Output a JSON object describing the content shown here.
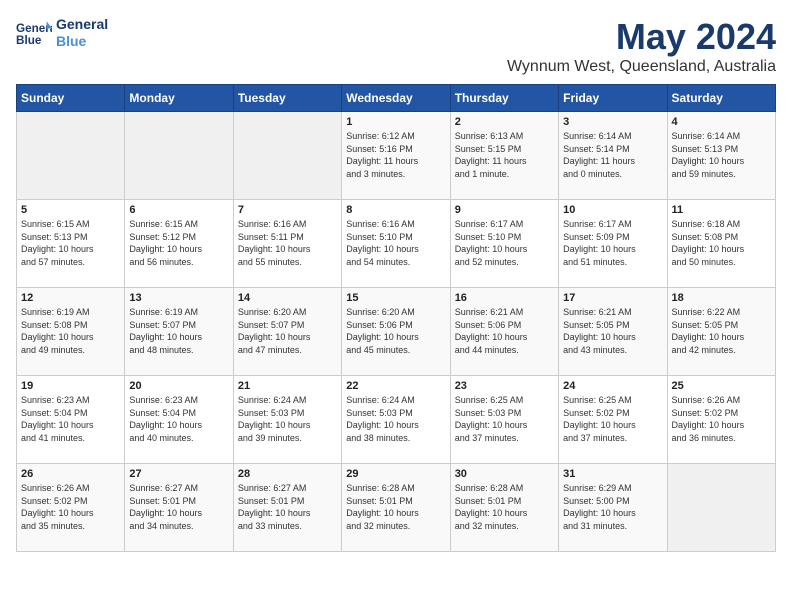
{
  "header": {
    "logo_line1": "General",
    "logo_line2": "Blue",
    "title": "May 2024",
    "subtitle": "Wynnum West, Queensland, Australia"
  },
  "days_of_week": [
    "Sunday",
    "Monday",
    "Tuesday",
    "Wednesday",
    "Thursday",
    "Friday",
    "Saturday"
  ],
  "weeks": [
    [
      {
        "day": "",
        "info": ""
      },
      {
        "day": "",
        "info": ""
      },
      {
        "day": "",
        "info": ""
      },
      {
        "day": "1",
        "info": "Sunrise: 6:12 AM\nSunset: 5:16 PM\nDaylight: 11 hours\nand 3 minutes."
      },
      {
        "day": "2",
        "info": "Sunrise: 6:13 AM\nSunset: 5:15 PM\nDaylight: 11 hours\nand 1 minute."
      },
      {
        "day": "3",
        "info": "Sunrise: 6:14 AM\nSunset: 5:14 PM\nDaylight: 11 hours\nand 0 minutes."
      },
      {
        "day": "4",
        "info": "Sunrise: 6:14 AM\nSunset: 5:13 PM\nDaylight: 10 hours\nand 59 minutes."
      }
    ],
    [
      {
        "day": "5",
        "info": "Sunrise: 6:15 AM\nSunset: 5:13 PM\nDaylight: 10 hours\nand 57 minutes."
      },
      {
        "day": "6",
        "info": "Sunrise: 6:15 AM\nSunset: 5:12 PM\nDaylight: 10 hours\nand 56 minutes."
      },
      {
        "day": "7",
        "info": "Sunrise: 6:16 AM\nSunset: 5:11 PM\nDaylight: 10 hours\nand 55 minutes."
      },
      {
        "day": "8",
        "info": "Sunrise: 6:16 AM\nSunset: 5:10 PM\nDaylight: 10 hours\nand 54 minutes."
      },
      {
        "day": "9",
        "info": "Sunrise: 6:17 AM\nSunset: 5:10 PM\nDaylight: 10 hours\nand 52 minutes."
      },
      {
        "day": "10",
        "info": "Sunrise: 6:17 AM\nSunset: 5:09 PM\nDaylight: 10 hours\nand 51 minutes."
      },
      {
        "day": "11",
        "info": "Sunrise: 6:18 AM\nSunset: 5:08 PM\nDaylight: 10 hours\nand 50 minutes."
      }
    ],
    [
      {
        "day": "12",
        "info": "Sunrise: 6:19 AM\nSunset: 5:08 PM\nDaylight: 10 hours\nand 49 minutes."
      },
      {
        "day": "13",
        "info": "Sunrise: 6:19 AM\nSunset: 5:07 PM\nDaylight: 10 hours\nand 48 minutes."
      },
      {
        "day": "14",
        "info": "Sunrise: 6:20 AM\nSunset: 5:07 PM\nDaylight: 10 hours\nand 47 minutes."
      },
      {
        "day": "15",
        "info": "Sunrise: 6:20 AM\nSunset: 5:06 PM\nDaylight: 10 hours\nand 45 minutes."
      },
      {
        "day": "16",
        "info": "Sunrise: 6:21 AM\nSunset: 5:06 PM\nDaylight: 10 hours\nand 44 minutes."
      },
      {
        "day": "17",
        "info": "Sunrise: 6:21 AM\nSunset: 5:05 PM\nDaylight: 10 hours\nand 43 minutes."
      },
      {
        "day": "18",
        "info": "Sunrise: 6:22 AM\nSunset: 5:05 PM\nDaylight: 10 hours\nand 42 minutes."
      }
    ],
    [
      {
        "day": "19",
        "info": "Sunrise: 6:23 AM\nSunset: 5:04 PM\nDaylight: 10 hours\nand 41 minutes."
      },
      {
        "day": "20",
        "info": "Sunrise: 6:23 AM\nSunset: 5:04 PM\nDaylight: 10 hours\nand 40 minutes."
      },
      {
        "day": "21",
        "info": "Sunrise: 6:24 AM\nSunset: 5:03 PM\nDaylight: 10 hours\nand 39 minutes."
      },
      {
        "day": "22",
        "info": "Sunrise: 6:24 AM\nSunset: 5:03 PM\nDaylight: 10 hours\nand 38 minutes."
      },
      {
        "day": "23",
        "info": "Sunrise: 6:25 AM\nSunset: 5:03 PM\nDaylight: 10 hours\nand 37 minutes."
      },
      {
        "day": "24",
        "info": "Sunrise: 6:25 AM\nSunset: 5:02 PM\nDaylight: 10 hours\nand 37 minutes."
      },
      {
        "day": "25",
        "info": "Sunrise: 6:26 AM\nSunset: 5:02 PM\nDaylight: 10 hours\nand 36 minutes."
      }
    ],
    [
      {
        "day": "26",
        "info": "Sunrise: 6:26 AM\nSunset: 5:02 PM\nDaylight: 10 hours\nand 35 minutes."
      },
      {
        "day": "27",
        "info": "Sunrise: 6:27 AM\nSunset: 5:01 PM\nDaylight: 10 hours\nand 34 minutes."
      },
      {
        "day": "28",
        "info": "Sunrise: 6:27 AM\nSunset: 5:01 PM\nDaylight: 10 hours\nand 33 minutes."
      },
      {
        "day": "29",
        "info": "Sunrise: 6:28 AM\nSunset: 5:01 PM\nDaylight: 10 hours\nand 32 minutes."
      },
      {
        "day": "30",
        "info": "Sunrise: 6:28 AM\nSunset: 5:01 PM\nDaylight: 10 hours\nand 32 minutes."
      },
      {
        "day": "31",
        "info": "Sunrise: 6:29 AM\nSunset: 5:00 PM\nDaylight: 10 hours\nand 31 minutes."
      },
      {
        "day": "",
        "info": ""
      }
    ]
  ]
}
